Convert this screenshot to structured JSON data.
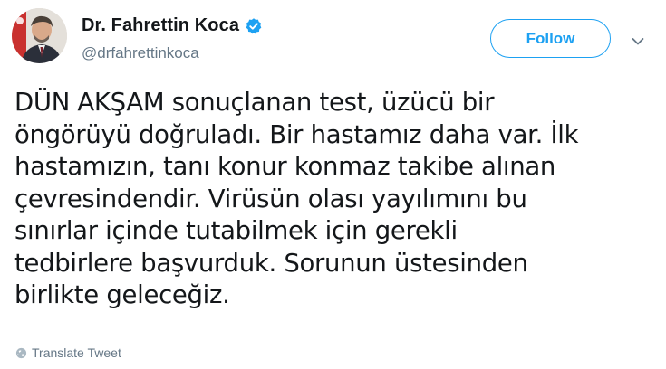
{
  "author": {
    "display_name": "Dr. Fahrettin Koca",
    "handle": "@drfahrettinkoca",
    "verified": true
  },
  "actions": {
    "follow_label": "Follow",
    "more_icon": "chevron-down-icon"
  },
  "tweet": {
    "text": "DÜN AKŞAM sonuçlanan test, üzücü bir\nöngörüyü doğruladı. Bir hastamız daha var. İlk\nhastamızın, tanı konur konmaz takibe alınan\nçevresindendir. Virüsün olası yayılımını bu\nsınırlar içinde tutabilmek için gerekli\ntedbirlere başvurduk. Sorunun üstesinden\nbirlikte geleceğiz."
  },
  "translate": {
    "label": "Translate Tweet",
    "icon": "globe-icon"
  },
  "colors": {
    "accent": "#1da1f2",
    "text_primary": "#14171a",
    "text_secondary": "#657786"
  }
}
